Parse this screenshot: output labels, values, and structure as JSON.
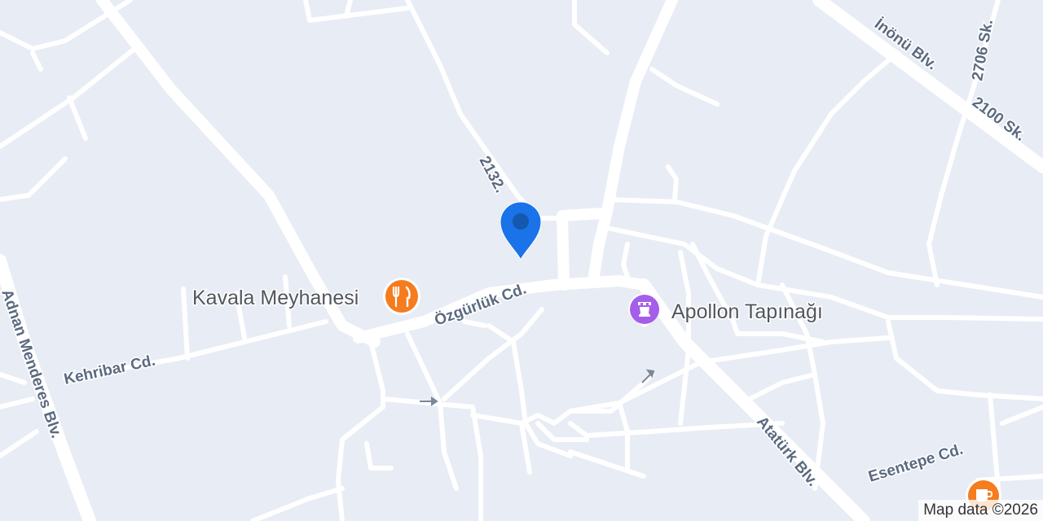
{
  "map": {
    "streets": {
      "inonu": "İnönü Blv.",
      "s2706": "2706 Sk.",
      "s2100": "2100 Sk.",
      "s2132": "2132.",
      "ozgurluk": "Özgürlük Cd.",
      "kehribar": "Kehribar Cd.",
      "adnan": "Adnan Menderes Blv.",
      "ataturk": "Atatürk Blv.",
      "esentepe": "Esentepe Cd."
    },
    "pois": [
      {
        "name": "Kavala Meyhanesi",
        "icon": "restaurant-icon",
        "color": "#f57c1f"
      },
      {
        "name": "Apollon Tapınağı",
        "icon": "landmark-icon",
        "color": "#a55eea"
      },
      {
        "name": "",
        "icon": "cafe-icon",
        "color": "#f57c1f"
      }
    ],
    "pin": {
      "icon": "location-pin-icon",
      "color": "#1a73e8"
    },
    "attribution": "Map data ©2026"
  }
}
